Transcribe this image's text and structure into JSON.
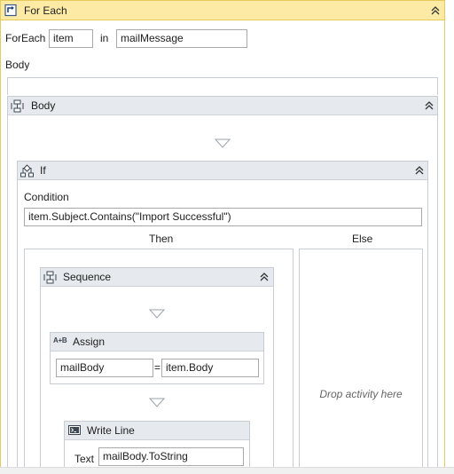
{
  "foreach": {
    "title": "For Each",
    "foreach_label": "ForEach",
    "item_value": "item",
    "in_label": "in",
    "collection_value": "mailMessage",
    "body_label": "Body"
  },
  "body_sequence": {
    "title": "Body"
  },
  "if_activity": {
    "title": "If",
    "condition_label": "Condition",
    "condition_value": "item.Subject.Contains(\"Import Successful\")",
    "then_label": "Then",
    "else_label": "Else",
    "else_placeholder": "Drop activity here"
  },
  "sequence": {
    "title": "Sequence"
  },
  "assign": {
    "icon_text": "A+B",
    "title": "Assign",
    "to_value": "mailBody",
    "equals": "=",
    "value": "item.Body"
  },
  "write_line": {
    "title": "Write Line",
    "text_label": "Text",
    "text_value": "mailBody.ToString"
  },
  "colors": {
    "foreach_header": "#fdeaa5",
    "foreach_border": "#e8c95e",
    "activity_header": "#e6e9ed",
    "activity_border": "#c8cdd3"
  }
}
